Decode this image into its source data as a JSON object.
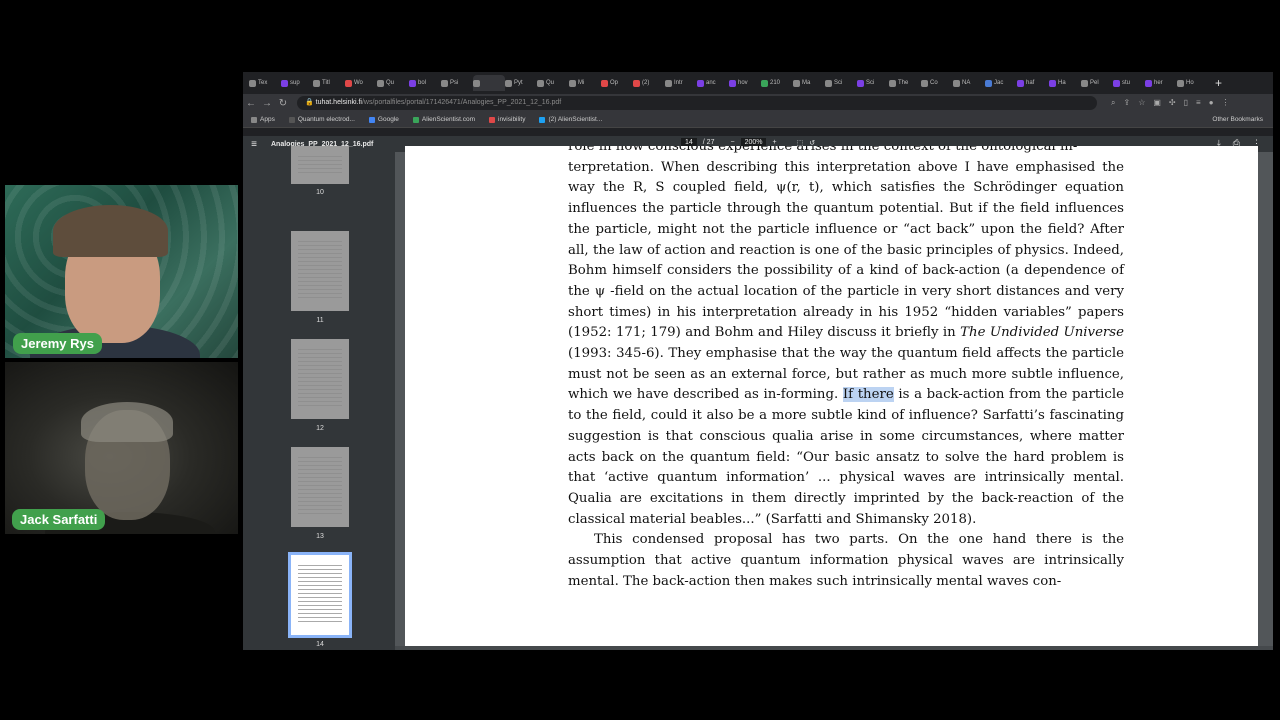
{
  "participants": [
    {
      "name": "Jeremy Rys"
    },
    {
      "name": "Jack Sarfatti"
    }
  ],
  "browser": {
    "tabs": [
      {
        "label": "Tex",
        "color": "#888888"
      },
      {
        "label": "sup",
        "color": "#7b3fe4"
      },
      {
        "label": "Titl",
        "color": "#888888"
      },
      {
        "label": "Wo",
        "color": "#e04848"
      },
      {
        "label": "Qu",
        "color": "#888888"
      },
      {
        "label": "bol",
        "color": "#7b3fe4"
      },
      {
        "label": "Psi",
        "color": "#888888"
      },
      {
        "label": "",
        "color": "#888888"
      },
      {
        "label": "Pyt",
        "color": "#888888"
      },
      {
        "label": "Qu",
        "color": "#888888"
      },
      {
        "label": "Mi",
        "color": "#888888"
      },
      {
        "label": "Op",
        "color": "#e04848"
      },
      {
        "label": "(2)",
        "color": "#e04848"
      },
      {
        "label": "Intr",
        "color": "#888888"
      },
      {
        "label": "anc",
        "color": "#7b3fe4"
      },
      {
        "label": "hov",
        "color": "#7b3fe4"
      },
      {
        "label": "210",
        "color": "#3aa55a"
      },
      {
        "label": "Ma",
        "color": "#888888"
      },
      {
        "label": "Sci",
        "color": "#888888"
      },
      {
        "label": "Sci",
        "color": "#7b3fe4"
      },
      {
        "label": "The",
        "color": "#888888"
      },
      {
        "label": "Co",
        "color": "#888888"
      },
      {
        "label": "NA",
        "color": "#888888"
      },
      {
        "label": "Jac",
        "color": "#4a7bd4"
      },
      {
        "label": "haf",
        "color": "#7b3fe4"
      },
      {
        "label": "Ha",
        "color": "#7b3fe4"
      },
      {
        "label": "Pel",
        "color": "#888888"
      },
      {
        "label": "stu",
        "color": "#7b3fe4"
      },
      {
        "label": "her",
        "color": "#7b3fe4"
      },
      {
        "label": "Ho",
        "color": "#888888"
      }
    ],
    "active_tab_index": 7,
    "address": {
      "host": "tuhat.helsinki.fi",
      "path": "/ws/portalfiles/portal/171426471/Analogies_PP_2021_12_16.pdf"
    },
    "bookmarks": [
      {
        "label": "Apps",
        "color": "#888888"
      },
      {
        "label": "Quantum electrod...",
        "color": "#555555"
      },
      {
        "label": "Google",
        "color": "#4285f4"
      },
      {
        "label": "AlienScientist.com",
        "color": "#3aa55a"
      },
      {
        "label": "invisibility",
        "color": "#e04848"
      },
      {
        "label": "(2) AlienScientist...",
        "color": "#1da1f2"
      }
    ],
    "other_bookmarks": "Other Bookmarks"
  },
  "pdf": {
    "filename": "Analogies_PP_2021_12_16.pdf",
    "current_page": "14",
    "total_pages": "/ 27",
    "zoom": "200%",
    "thumbnails": [
      {
        "label": "10"
      },
      {
        "label": "11"
      },
      {
        "label": "12"
      },
      {
        "label": "13"
      },
      {
        "label": "14"
      }
    ],
    "text": {
      "line0": "role in how conscious experience arises in the context of the ontological in-",
      "p1_before": "terpretation.  When describing this interpretation above I have emphasised the way the R, S coupled field, ψ(r, t), which satisfies the Schrödinger equation influences the particle through the quantum potential.  But if the field influences the particle, might not the particle influence or “act back” upon the field?  After all, the law of action and reaction is one of the basic principles of physics.  Indeed, Bohm himself considers the possibility of a kind of back-action (a dependence of the ψ -field on the actual location of the particle in very short distances and very short times) in his interpretation already in his 1952 “hidden variables” papers (1952: 171; 179) and Bohm and Hiley discuss it briefly in ",
      "book": "The Undivided Universe",
      "p1_mid": " (1993: 345-6).  They emphasise that the way the quantum field affects the particle must not be seen as an external force, but rather as much more subtle influence, which we have described as in-forming.  ",
      "highlight": "If there",
      "p1_after": " is a back-action from the particle to the field, could it also be a more subtle kind of influence?  Sarfatti’s fascinating suggestion is that conscious qualia arise in some circumstances, where matter acts back on the quantum field:  “Our basic ansatz to solve the hard problem is that ‘active quantum information’ ... physical waves are intrinsically mental.  Qualia are excitations in them directly imprinted by the back-reaction of the classical material beables...”  (Sarfatti and Shimansky 2018).",
      "p2": "This condensed proposal has two parts.  On the one hand there is the assumption that active quantum information physical waves are intrinsically mental.  The back-action then makes such intrinsically mental waves con-"
    }
  }
}
